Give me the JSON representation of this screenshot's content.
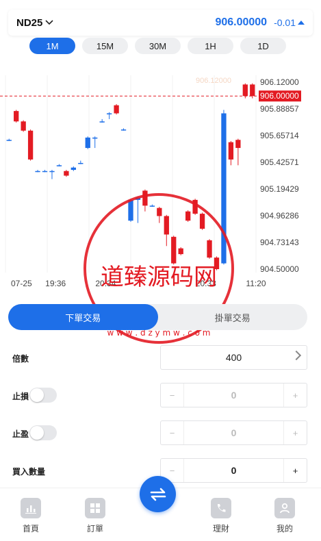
{
  "header": {
    "symbol": "ND25",
    "price": "906.00000",
    "change": "-0.01"
  },
  "intervals": [
    "1M",
    "15M",
    "30M",
    "1H",
    "1D"
  ],
  "active_interval": "1M",
  "chart_data": {
    "type": "candlestick",
    "title": "",
    "y_ticks": [
      "906.12000",
      "905.88857",
      "905.65714",
      "905.42571",
      "905.19429",
      "904.96286",
      "904.73143",
      "904.50000"
    ],
    "ylim": [
      904.5,
      906.12
    ],
    "x_ticks": [
      "07-25",
      "19:36",
      "20:34",
      "",
      "20:33",
      "11:20"
    ],
    "current_price_label": "906.00000",
    "faded_price_label": "906.12000",
    "colors": {
      "up": "#e31b23",
      "down": "#1e6fe8",
      "current_line": "#e31b23"
    },
    "candles": [
      {
        "o": 905.62,
        "c": 905.62,
        "h": 905.63,
        "l": 905.61
      },
      {
        "o": 905.87,
        "c": 905.78,
        "h": 905.88,
        "l": 905.77
      },
      {
        "o": 905.78,
        "c": 905.7,
        "h": 905.79,
        "l": 905.69
      },
      {
        "o": 905.7,
        "c": 905.45,
        "h": 905.71,
        "l": 905.44
      },
      {
        "o": 905.35,
        "c": 905.35,
        "h": 905.36,
        "l": 905.34
      },
      {
        "o": 905.35,
        "c": 905.35,
        "h": 905.36,
        "l": 905.34
      },
      {
        "o": 905.35,
        "c": 905.35,
        "h": 905.36,
        "l": 905.28
      },
      {
        "o": 905.4,
        "c": 905.4,
        "h": 905.41,
        "l": 905.39
      },
      {
        "o": 905.35,
        "c": 905.31,
        "h": 905.36,
        "l": 905.3
      },
      {
        "o": 905.36,
        "c": 905.38,
        "h": 905.39,
        "l": 905.35
      },
      {
        "o": 905.42,
        "c": 905.42,
        "h": 905.44,
        "l": 905.41
      },
      {
        "o": 905.55,
        "c": 905.64,
        "h": 905.65,
        "l": 905.54
      },
      {
        "o": 905.64,
        "c": 905.64,
        "h": 905.65,
        "l": 905.55
      },
      {
        "o": 905.78,
        "c": 905.78,
        "h": 905.8,
        "l": 905.77
      },
      {
        "o": 905.85,
        "c": 905.85,
        "h": 905.86,
        "l": 905.8
      },
      {
        "o": 905.92,
        "c": 905.85,
        "h": 905.93,
        "l": 905.84
      },
      {
        "o": 905.71,
        "c": 905.71,
        "h": 905.72,
        "l": 905.7
      },
      {
        "o": 904.92,
        "c": 905.1,
        "h": 905.11,
        "l": 904.91
      },
      {
        "o": 905.1,
        "c": 905.12,
        "h": 905.13,
        "l": 904.9
      },
      {
        "o": 905.18,
        "c": 905.05,
        "h": 905.19,
        "l": 905.0
      },
      {
        "o": 905.05,
        "c": 905.05,
        "h": 905.06,
        "l": 905.04
      },
      {
        "o": 905.03,
        "c": 904.96,
        "h": 905.04,
        "l": 904.9
      },
      {
        "o": 904.96,
        "c": 904.8,
        "h": 904.97,
        "l": 904.7
      },
      {
        "o": 904.78,
        "c": 904.55,
        "h": 904.79,
        "l": 904.54
      },
      {
        "o": 904.68,
        "c": 904.63,
        "h": 904.69,
        "l": 904.62
      },
      {
        "o": 905.0,
        "c": 904.92,
        "h": 905.01,
        "l": 904.91
      },
      {
        "o": 905.1,
        "c": 904.98,
        "h": 905.11,
        "l": 904.97
      },
      {
        "o": 904.98,
        "c": 904.85,
        "h": 904.99,
        "l": 904.84
      },
      {
        "o": 904.75,
        "c": 904.6,
        "h": 904.76,
        "l": 904.59
      },
      {
        "o": 904.6,
        "c": 904.5,
        "h": 904.61,
        "l": 904.49
      },
      {
        "o": 904.55,
        "c": 905.85,
        "h": 905.88,
        "l": 904.54
      },
      {
        "o": 905.6,
        "c": 905.45,
        "h": 905.61,
        "l": 905.4
      },
      {
        "o": 905.62,
        "c": 905.55,
        "h": 905.63,
        "l": 905.4
      },
      {
        "o": 906.1,
        "c": 906.0,
        "h": 906.11,
        "l": 905.98
      },
      {
        "o": 906.1,
        "c": 906.0,
        "h": 906.11,
        "l": 905.98
      }
    ]
  },
  "watermark": {
    "text": "道臻源码网",
    "url": "w w w . d z y m w . c o m"
  },
  "trade_tabs": [
    "下單交易",
    "掛單交易"
  ],
  "form": {
    "leverage_label": "倍數",
    "leverage_value": "400",
    "stop_loss_label": "止損",
    "stop_loss_value": "0",
    "take_profit_label": "止盈",
    "take_profit_value": "0",
    "quantity_label": "買入數量",
    "quantity_value": "0",
    "minus": "−",
    "plus": "+"
  },
  "nav": {
    "home": "首頁",
    "orders": "訂單",
    "wealth": "理財",
    "mine": "我的"
  }
}
